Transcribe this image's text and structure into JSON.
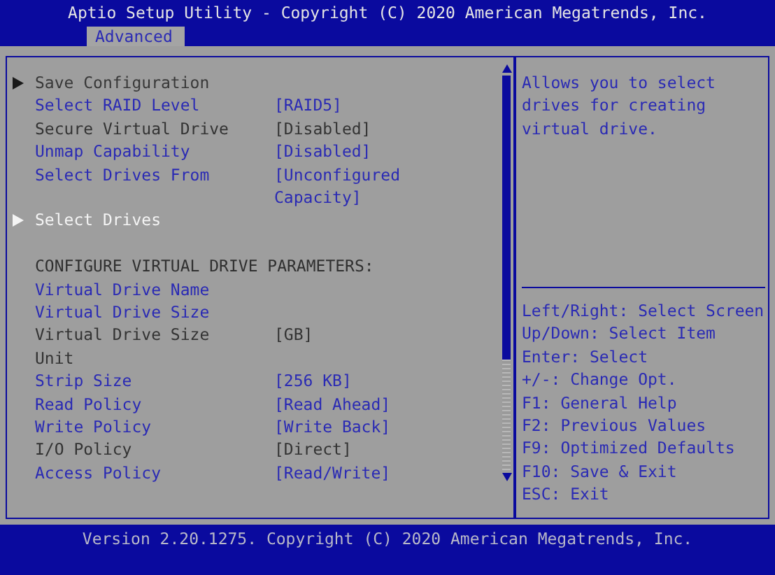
{
  "title": "Aptio Setup Utility - Copyright (C) 2020 American Megatrends, Inc.",
  "tabs": [
    {
      "label": "Advanced",
      "selected": true
    }
  ],
  "items": [
    {
      "kind": "submenu",
      "label": "Save Configuration",
      "enabled": false,
      "selected": false
    },
    {
      "kind": "option",
      "label": "Select RAID Level",
      "value": "[RAID5]",
      "enabled": true,
      "selected": false
    },
    {
      "kind": "option",
      "label": "Secure Virtual Drive",
      "value": "[Disabled]",
      "enabled": false,
      "selected": false
    },
    {
      "kind": "option",
      "label": "Unmap Capability",
      "value": "[Disabled]",
      "enabled": true,
      "selected": false
    },
    {
      "kind": "option",
      "label": "Select Drives From",
      "value": "[Unconfigured Capacity]",
      "enabled": true,
      "selected": false
    },
    {
      "kind": "submenu",
      "label": "Select Drives",
      "enabled": true,
      "selected": true
    },
    {
      "kind": "heading",
      "label": "CONFIGURE VIRTUAL DRIVE PARAMETERS:"
    },
    {
      "kind": "option",
      "label": "Virtual Drive Name",
      "value": "",
      "enabled": true,
      "selected": false
    },
    {
      "kind": "option",
      "label": "Virtual Drive Size",
      "value": "",
      "enabled": true,
      "selected": false
    },
    {
      "kind": "option",
      "label": "Virtual Drive Size Unit",
      "value": "[GB]",
      "enabled": false,
      "selected": false
    },
    {
      "kind": "option",
      "label": "Strip Size",
      "value": "[256 KB]",
      "enabled": true,
      "selected": false
    },
    {
      "kind": "option",
      "label": "Read Policy",
      "value": "[Read Ahead]",
      "enabled": true,
      "selected": false
    },
    {
      "kind": "option",
      "label": "Write Policy",
      "value": "[Write Back]",
      "enabled": true,
      "selected": false
    },
    {
      "kind": "option",
      "label": "I/O Policy",
      "value": "[Direct]",
      "enabled": false,
      "selected": false
    },
    {
      "kind": "option",
      "label": "Access Policy",
      "value": "[Read/Write]",
      "enabled": true,
      "selected": false
    }
  ],
  "help": "Allows you to select drives for creating virtual drive.",
  "keys": [
    "Left/Right: Select Screen",
    "Up/Down: Select Item",
    "Enter: Select",
    "+/-: Change Opt.",
    "F1: General Help",
    "F2: Previous Values",
    "F9: Optimized Defaults",
    "F10: Save & Exit",
    "ESC: Exit"
  ],
  "footer": "Version 2.20.1275. Copyright (C) 2020 American Megatrends, Inc."
}
